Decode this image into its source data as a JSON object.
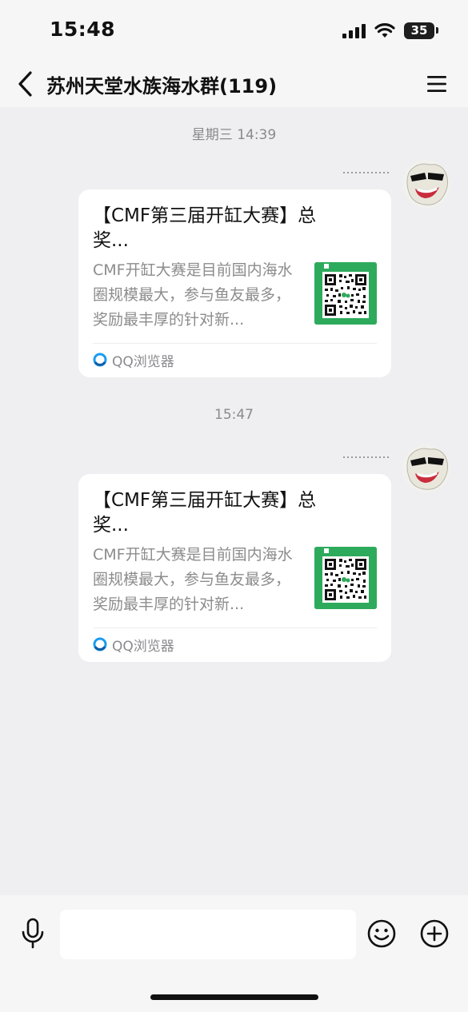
{
  "status_bar": {
    "time": "15:48",
    "battery": "35"
  },
  "nav": {
    "title": "苏州天堂水族海水群(119)"
  },
  "messages": [
    {
      "timestamp": "星期三 14:39",
      "card": {
        "title": "【CMF第三届开缸大赛】总奖...",
        "description": "CMF开缸大赛是目前国内海水圈规模最大，参与鱼友最多，奖励最丰厚的针对新...",
        "source": "QQ浏览器"
      }
    },
    {
      "timestamp": "15:47",
      "card": {
        "title": "【CMF第三届开缸大赛】总奖...",
        "description": "CMF开缸大赛是目前国内海水圈规模最大，参与鱼友最多，奖励最丰厚的针对新...",
        "source": "QQ浏览器"
      }
    }
  ],
  "input_bar": {
    "placeholder": ""
  },
  "colors": {
    "background": "#efeff1",
    "bar": "#f6f6f7",
    "thumbnail_green": "#2eaa5c",
    "secondary_text": "#8a8a8e"
  }
}
